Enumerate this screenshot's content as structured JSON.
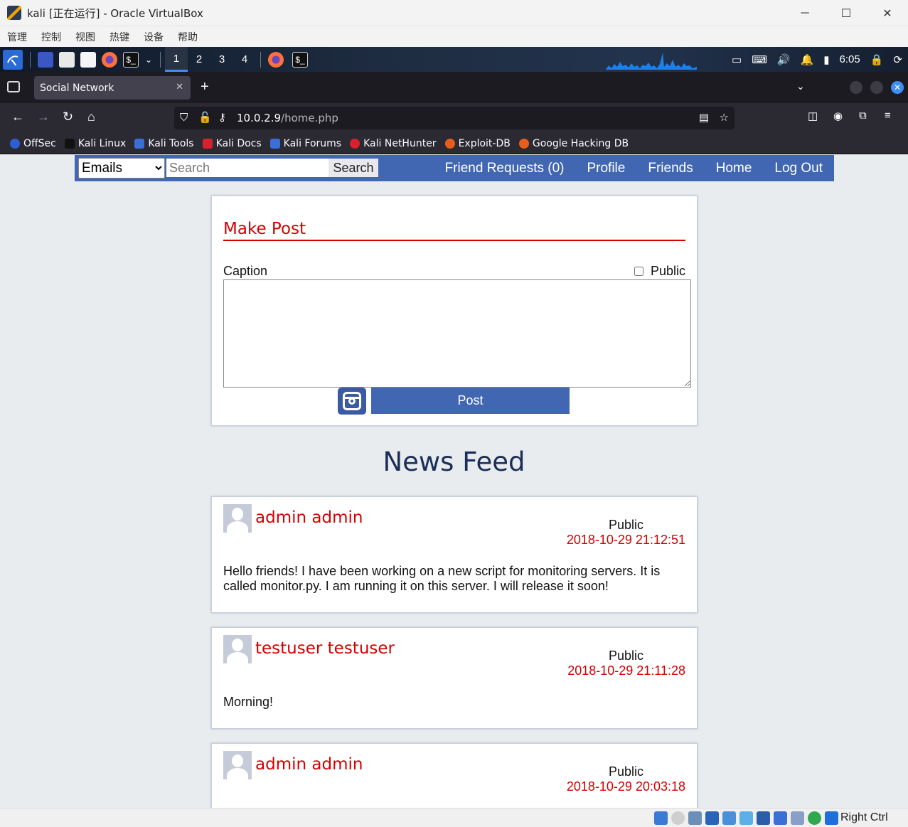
{
  "window": {
    "title": "kali [正在运行] - Oracle VirtualBox",
    "minimize": "─",
    "maximize": "☐",
    "close": "✕"
  },
  "vb_menu": [
    "管理",
    "控制",
    "视图",
    "热键",
    "设备",
    "帮助"
  ],
  "kali_panel": {
    "workspaces": [
      "1",
      "2",
      "3",
      "4"
    ],
    "active_workspace": "1",
    "clock": "6:05"
  },
  "browser": {
    "tab_title": "Social Network",
    "tab_close": "✕",
    "new_tab": "+",
    "url_host": "10.0.2.9",
    "url_path": "/home.php",
    "bookmarks": [
      "OffSec",
      "Kali Linux",
      "Kali Tools",
      "Kali Docs",
      "Kali Forums",
      "Kali NetHunter",
      "Exploit-DB",
      "Google Hacking DB"
    ]
  },
  "site_nav": {
    "select_value": "Emails",
    "search_placeholder": "Search",
    "search_button": "Search",
    "links": [
      "Friend Requests (0)",
      "Profile",
      "Friends",
      "Home",
      "Log Out"
    ]
  },
  "make_post": {
    "title": "Make Post",
    "caption_label": "Caption",
    "public_label": "Public",
    "post_button": "Post"
  },
  "news_feed": {
    "title": "News Feed",
    "posts": [
      {
        "author": "admin admin",
        "privacy": "Public",
        "date": "2018-10-29 21:12:51",
        "text": "Hello friends! I have been working on a new script for monitoring servers. It is called monitor.py. I am running it on this server. I will release it soon!"
      },
      {
        "author": "testuser testuser",
        "privacy": "Public",
        "date": "2018-10-29 21:11:28",
        "text": "Morning!"
      },
      {
        "author": "admin admin",
        "privacy": "Public",
        "date": "2018-10-29 20:03:18",
        "text": ""
      }
    ]
  },
  "vb_status": {
    "host_key": "Right Ctrl"
  },
  "colors": {
    "brand": "#4267b2",
    "accent_red": "#d40000",
    "feed_title": "#1b2e57"
  }
}
